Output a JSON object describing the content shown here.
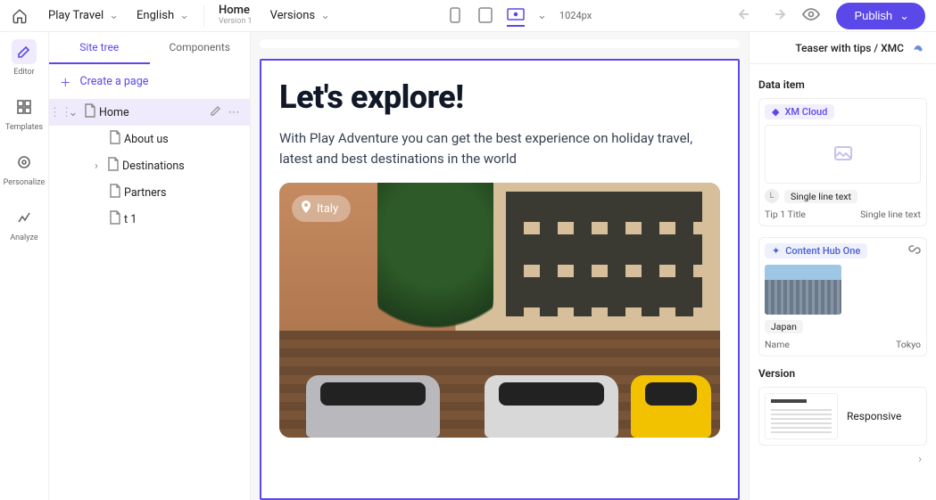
{
  "topbar": {
    "site": "Play Travel",
    "language": "English",
    "page": "Home",
    "page_sub": "Version 1",
    "versions": "Versions",
    "breakpoint": "1024px",
    "publish": "Publish"
  },
  "rail": {
    "items": [
      {
        "id": "editor",
        "label": "Editor"
      },
      {
        "id": "templates",
        "label": "Templates"
      },
      {
        "id": "personalize",
        "label": "Personalize"
      },
      {
        "id": "analyze",
        "label": "Analyze"
      }
    ]
  },
  "tree": {
    "tabs": {
      "site": "Site tree",
      "components": "Components"
    },
    "create": "Create a page",
    "nodes": {
      "home": "Home",
      "about": "About us",
      "dest": "Destinations",
      "partners": "Partners",
      "t1": "t 1"
    }
  },
  "canvas": {
    "heading": "Let's explore!",
    "paragraph": "With Play Adventure you can get the best experience on holiday travel, latest and best destinations in the world",
    "tag": "Italy"
  },
  "rhs": {
    "header": "Teaser with tips / XMC",
    "data_item": "Data item",
    "xm": {
      "chip": "XM Cloud",
      "field_label": "Single line text",
      "tip_label": "Tip 1 Title",
      "tip_type": "Single line text",
      "badge": "L"
    },
    "hub": {
      "chip": "Content Hub One",
      "tag": "Japan",
      "name_label": "Name",
      "name_value": "Tokyo"
    },
    "version_label": "Version",
    "version_name": "Responsive"
  }
}
